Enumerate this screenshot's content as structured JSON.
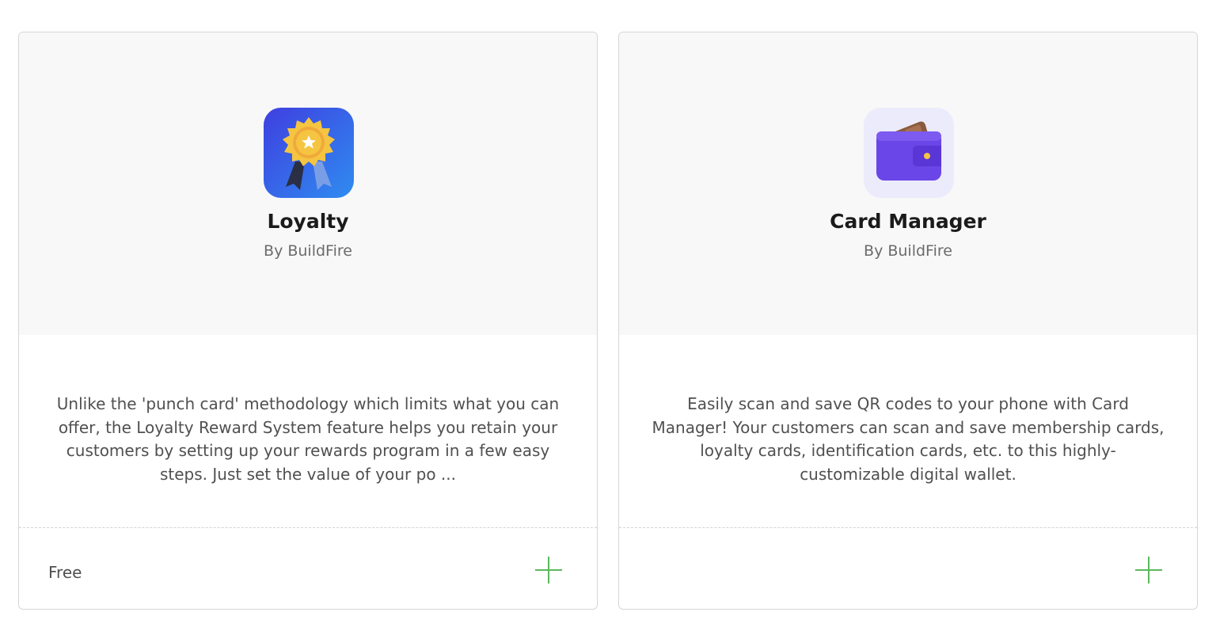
{
  "cards": [
    {
      "title": "Loyalty",
      "author": "By BuildFire",
      "description": "Unlike the 'punch card' methodology which limits what you can offer, the Loyalty Reward System feature helps you retain your customers by setting up your rewards program in a few easy steps. Just set the value of your po ...",
      "price": "Free",
      "icon": "medal-icon",
      "accent": "#3b56e6"
    },
    {
      "title": "Card Manager",
      "author": "By BuildFire",
      "description": "Easily scan and save QR codes to your phone with Card Manager! Your customers can scan and save membership cards, loyalty cards, identification cards, etc. to this highly-customizable digital wallet.",
      "price": "",
      "icon": "wallet-icon",
      "accent": "#6a45e8"
    }
  ],
  "colors": {
    "add_button": "#5cb85c",
    "card_header_bg": "#f8f8f8",
    "border": "#d6d6d6"
  }
}
